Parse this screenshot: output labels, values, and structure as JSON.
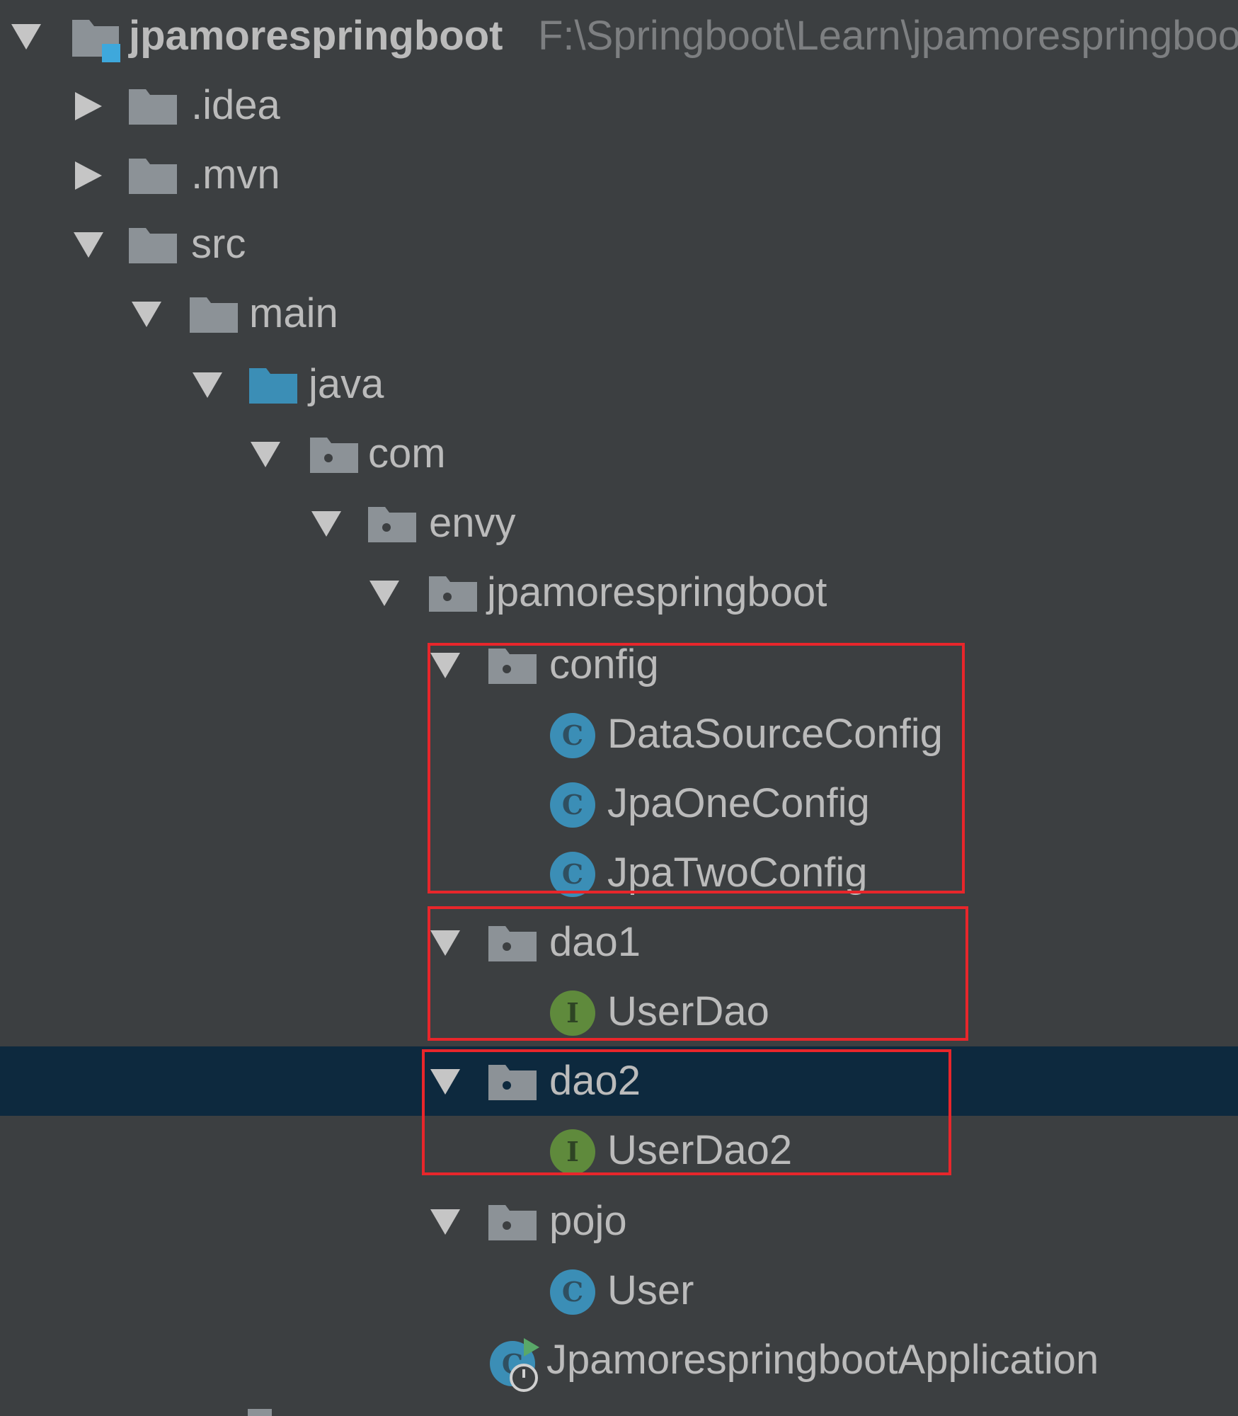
{
  "project_tree": {
    "root": {
      "name": "jpamorespringboot",
      "path": "F:\\Springboot\\Learn\\jpamorespringboot"
    },
    "items": [
      {
        "label": ".idea"
      },
      {
        "label": ".mvn"
      },
      {
        "label": "src"
      },
      {
        "label": "main"
      },
      {
        "label": "java"
      },
      {
        "label": "com"
      },
      {
        "label": "envy"
      },
      {
        "label": "jpamorespringboot"
      },
      {
        "label": "config"
      },
      {
        "label": "DataSourceConfig",
        "badge": "C"
      },
      {
        "label": "JpaOneConfig",
        "badge": "C"
      },
      {
        "label": "JpaTwoConfig",
        "badge": "C"
      },
      {
        "label": "dao1"
      },
      {
        "label": "UserDao",
        "badge": "I"
      },
      {
        "label": "dao2",
        "selected": true
      },
      {
        "label": "UserDao2",
        "badge": "I"
      },
      {
        "label": "pojo"
      },
      {
        "label": "User",
        "badge": "C"
      },
      {
        "label": "JpamorespringbootApplication"
      }
    ]
  },
  "colors": {
    "background": "#3c3f41",
    "selection": "#0d293e",
    "text": "#bbbbbb",
    "path_text": "#7d7f81",
    "folder": "#8c9297",
    "source_folder": "#3b8eb6",
    "class_badge": "#3b8eb6",
    "interface_badge": "#5f8a3c",
    "highlight_box": "#e8262b"
  },
  "icons": {
    "root": "project-module-icon",
    "folder": "folder-icon",
    "source_folder": "source-root-folder-icon",
    "package": "package-icon",
    "class": "class-icon",
    "interface": "interface-icon",
    "application": "spring-boot-application-icon",
    "expanded": "chevron-down-icon",
    "collapsed": "chevron-right-icon"
  }
}
